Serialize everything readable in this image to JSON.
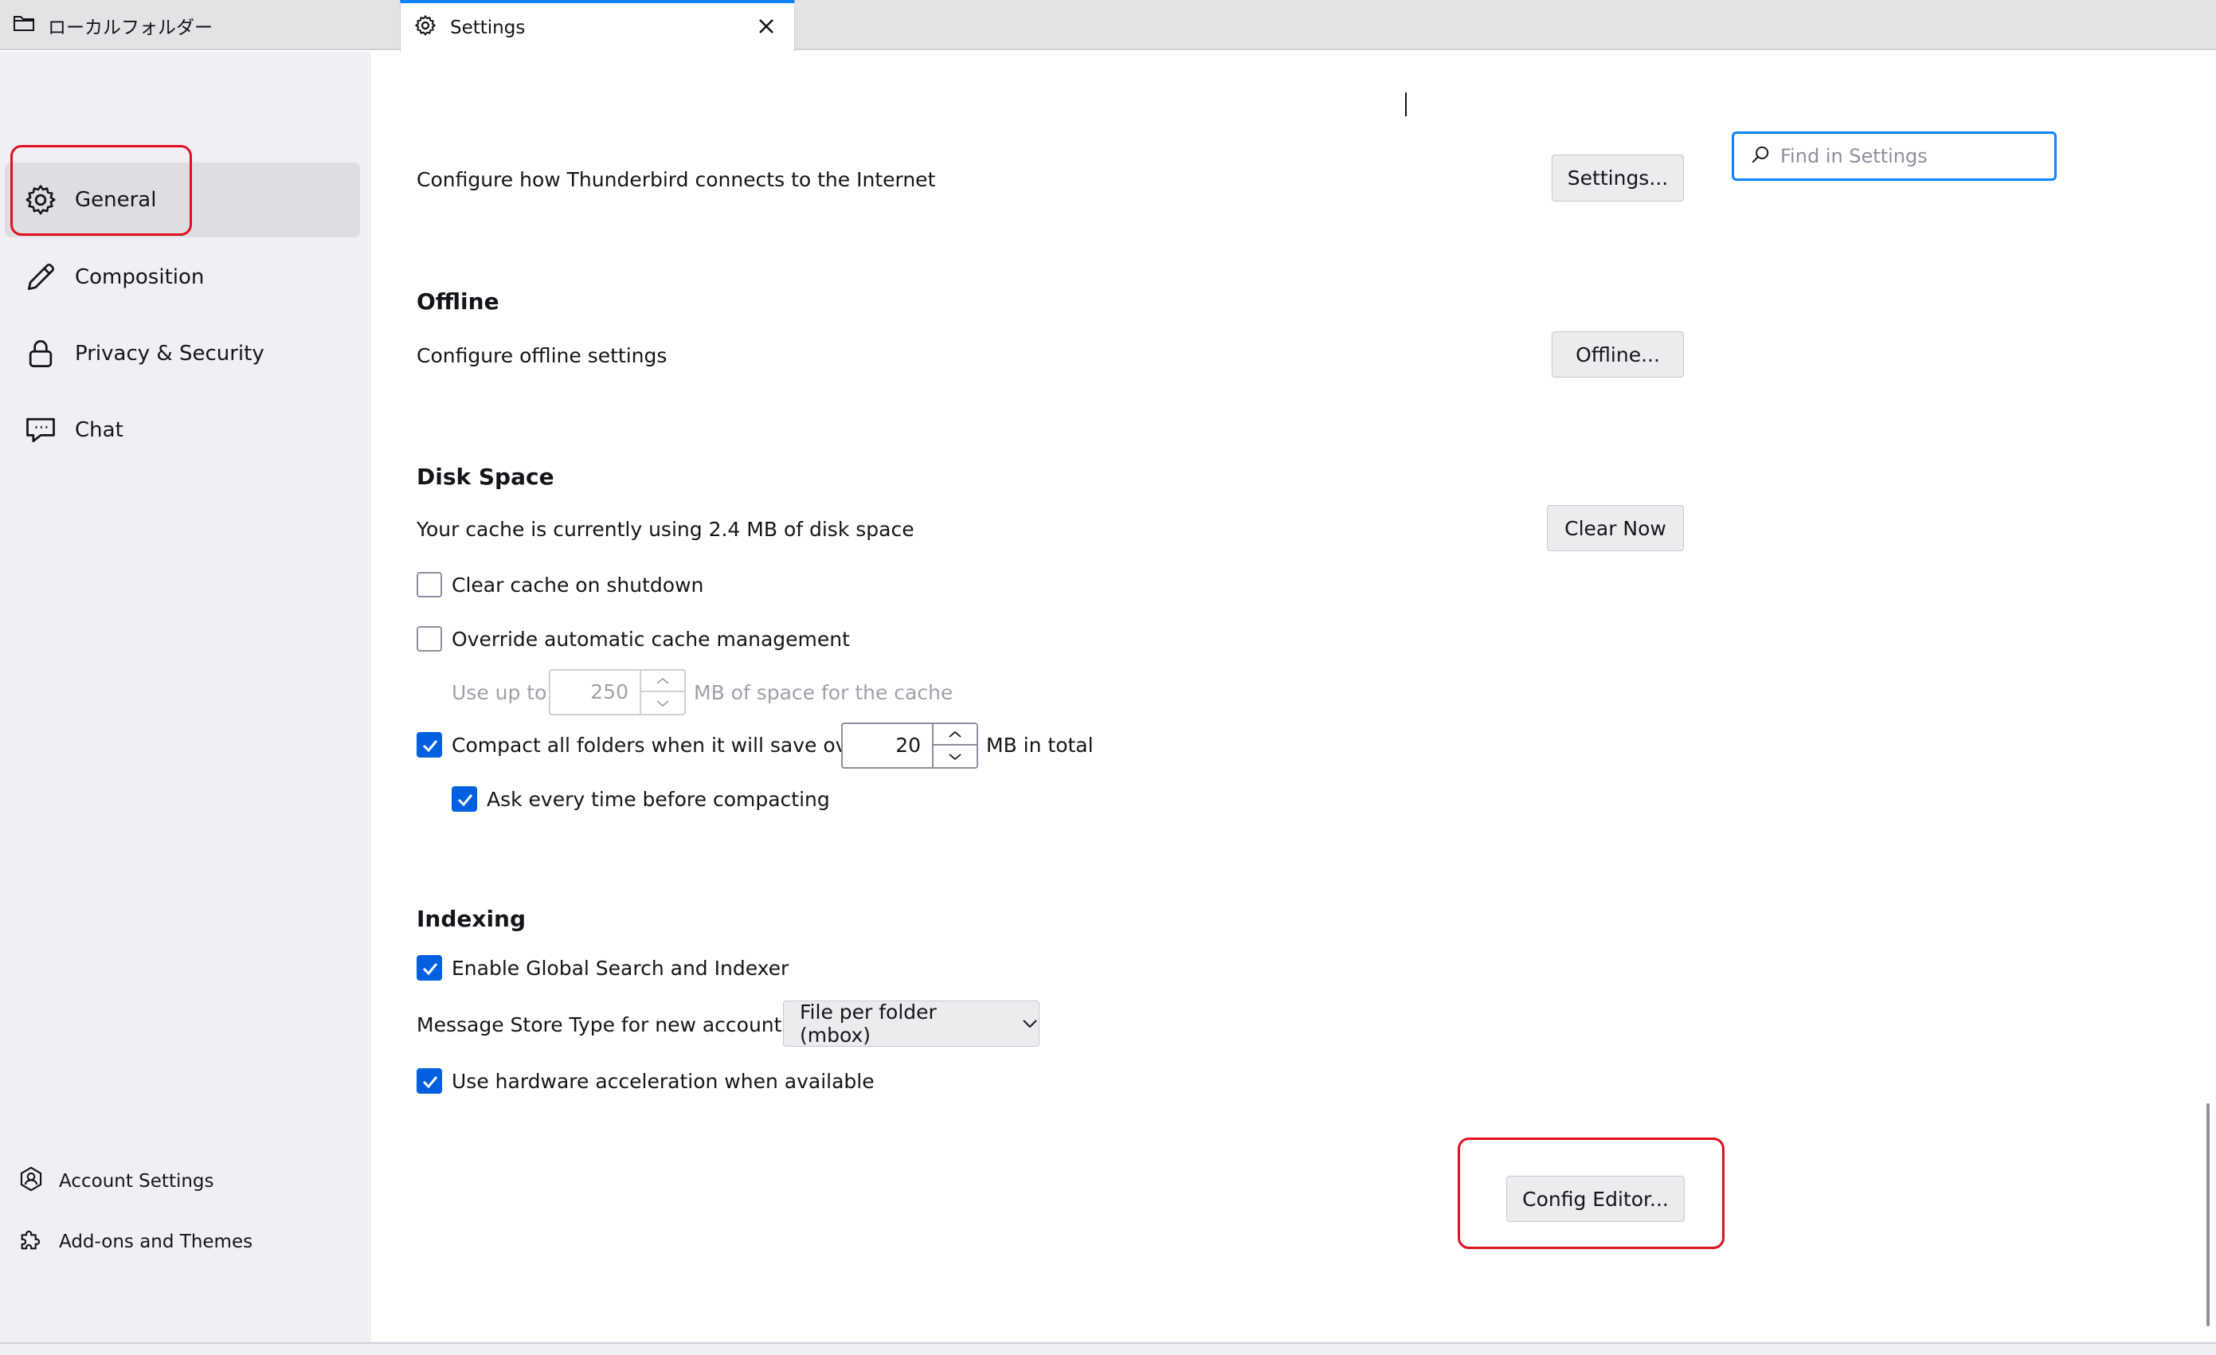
{
  "tabs": [
    {
      "label": "ローカルフォルダー",
      "icon": "folder-icon"
    },
    {
      "label": "Settings",
      "icon": "gear-icon",
      "active": true
    }
  ],
  "sidebar": {
    "items": [
      {
        "label": "General",
        "icon": "gear-icon",
        "selected": true
      },
      {
        "label": "Composition",
        "icon": "pencil-icon"
      },
      {
        "label": "Privacy & Security",
        "icon": "lock-icon"
      },
      {
        "label": "Chat",
        "icon": "chat-icon"
      }
    ],
    "footer": [
      {
        "label": "Account Settings",
        "icon": "account-icon"
      },
      {
        "label": "Add-ons and Themes",
        "icon": "puzzle-icon"
      }
    ]
  },
  "search": {
    "placeholder": "Find in Settings",
    "value": ""
  },
  "connection": {
    "description": "Configure how Thunderbird connects to the Internet",
    "button": "Settings..."
  },
  "offline": {
    "title": "Offline",
    "description": "Configure offline settings",
    "button": "Offline..."
  },
  "disk_space": {
    "title": "Disk Space",
    "cache_usage": "Your cache is currently using 2.4 MB of disk space",
    "clear_button": "Clear Now",
    "clear_on_shutdown": {
      "label": "Clear cache on shutdown",
      "checked": false
    },
    "override_cache": {
      "label": "Override automatic cache management",
      "checked": false
    },
    "use_up_to": {
      "prefix": "Use up to",
      "value": "250",
      "suffix": "MB of space for the cache",
      "disabled": true
    },
    "compact": {
      "label": "Compact all folders when it will save over",
      "value": "20",
      "suffix": "MB in total",
      "checked": true
    },
    "ask_before_compact": {
      "label": "Ask every time before compacting",
      "checked": true
    }
  },
  "indexing": {
    "title": "Indexing",
    "global_search": {
      "label": "Enable Global Search and Indexer",
      "checked": true
    },
    "store_type_label": "Message Store Type for new accounts:",
    "store_type_value": "File per folder (mbox)",
    "hardware_accel": {
      "label": "Use hardware acceleration when available",
      "checked": true
    }
  },
  "config_editor_button": "Config Editor...",
  "colors": {
    "accent": "#0a84ff",
    "checkbox": "#0060df",
    "highlight": "#e0101e"
  }
}
